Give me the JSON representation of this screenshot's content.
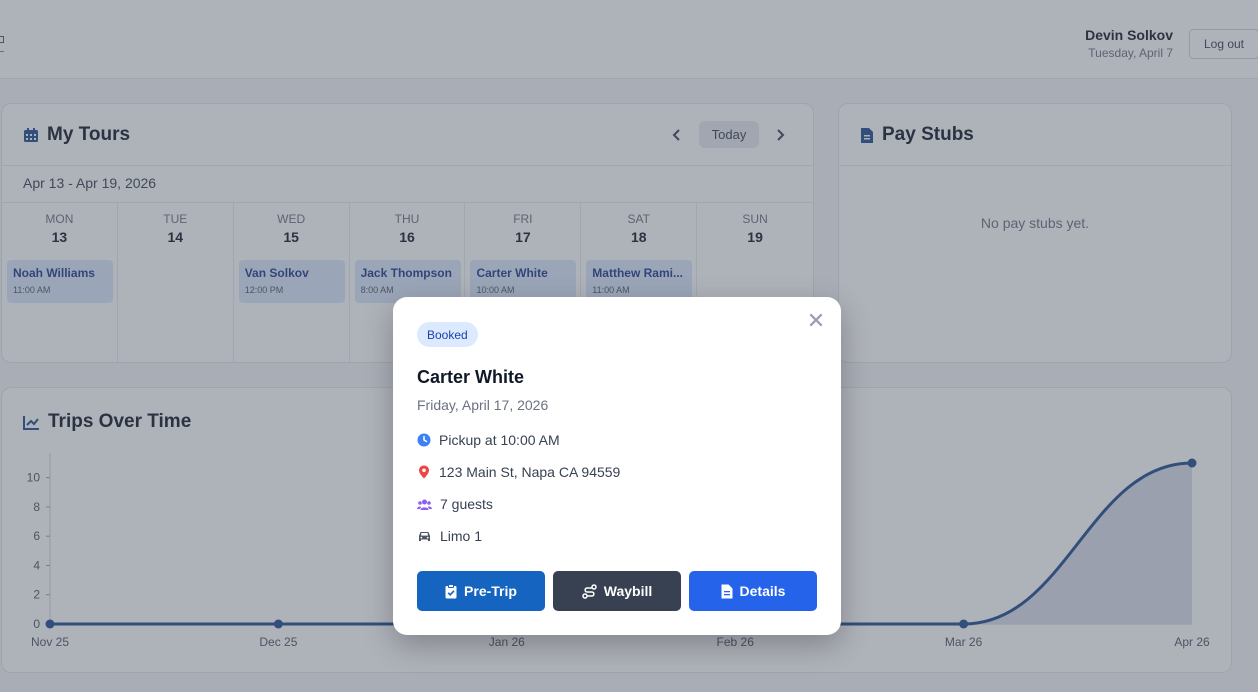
{
  "header": {
    "user_name": "Devin Solkov",
    "date": "Tuesday, April 7",
    "logout_label": "Log out"
  },
  "tours": {
    "title": "My Tours",
    "today_label": "Today",
    "range": "Apr 13 - Apr 19, 2026",
    "days": [
      {
        "dow": "MON",
        "num": "13"
      },
      {
        "dow": "TUE",
        "num": "14"
      },
      {
        "dow": "WED",
        "num": "15"
      },
      {
        "dow": "THU",
        "num": "16"
      },
      {
        "dow": "FRI",
        "num": "17"
      },
      {
        "dow": "SAT",
        "num": "18"
      },
      {
        "dow": "SUN",
        "num": "19"
      }
    ],
    "events": [
      {
        "name": "Noah Williams",
        "time": "11:00 AM"
      },
      {
        "name": "Van Solkov",
        "time": "12:00 PM"
      },
      {
        "name": "Jack Thompson",
        "time": "8:00 AM"
      },
      {
        "name": "Carter White",
        "time": "10:00 AM"
      },
      {
        "name": "Matthew Rami...",
        "time": "11:00 AM"
      }
    ]
  },
  "paystubs": {
    "title": "Pay Stubs",
    "empty": "No pay stubs yet."
  },
  "trips": {
    "title": "Trips Over Time"
  },
  "chart_data": {
    "type": "area",
    "title": "Trips Over Time",
    "x": [
      "Nov 25",
      "Dec 25",
      "Jan 26",
      "Feb 26",
      "Mar 26",
      "Apr 26"
    ],
    "values": [
      0,
      0,
      0,
      0,
      0,
      11
    ],
    "yticks": [
      0,
      2,
      4,
      6,
      8,
      10
    ],
    "ylim": [
      0,
      11
    ],
    "colors": {
      "line": "#1e4a8c",
      "fill": "#d6dcea"
    }
  },
  "modal": {
    "status": "Booked",
    "name": "Carter White",
    "date": "Friday, April 17, 2026",
    "pickup": "Pickup at 10:00 AM",
    "address": "123 Main St, Napa CA 94559",
    "guests": "7 guests",
    "vehicle": "Limo 1",
    "buttons": {
      "pretrip": "Pre-Trip",
      "waybill": "Waybill",
      "details": "Details"
    },
    "colors": {
      "pretrip": "#1565c0",
      "waybill": "#374151",
      "details": "#2563eb"
    }
  }
}
